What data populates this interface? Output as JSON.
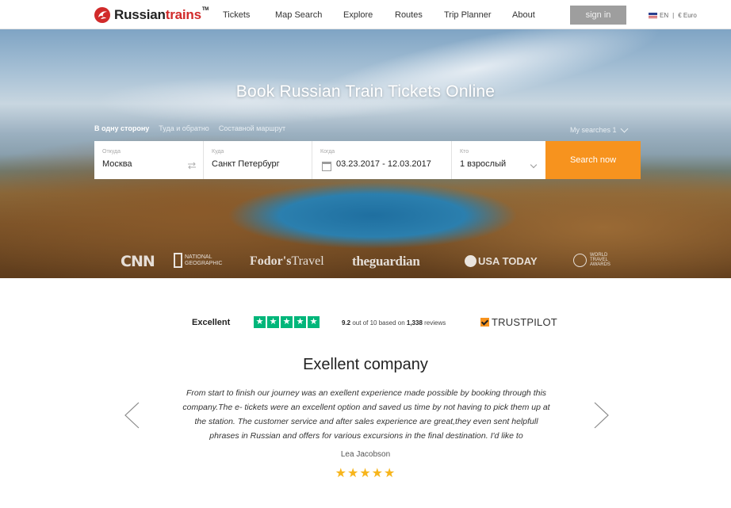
{
  "brand": {
    "name_part1": "Russian",
    "name_part2": "trains",
    "tm": "TM",
    "accent_color": "#d12a2a"
  },
  "nav": {
    "items": [
      "Tickets",
      "Map Search",
      "Explore",
      "Routes",
      "Trip Planner",
      "About"
    ],
    "signin_label": "sign in",
    "lang": "EN",
    "separator": "|",
    "currency": "€ Euro"
  },
  "hero": {
    "title": "Book Russian Train Tickets Online",
    "tabs": [
      "В одну сторону",
      "Туда и обратно",
      "Составной маршрут"
    ],
    "active_tab": 0,
    "my_searches": "My searches 1"
  },
  "search": {
    "from_label": "Откуда",
    "from_value": "Москва",
    "to_label": "Куда",
    "to_value": "Санкт Петербург",
    "date_label": "Когда",
    "date_value": "03.23.2017 - 12.03.2017",
    "who_label": "Кто",
    "who_value": "1 взрослый",
    "button_label": "Search now",
    "button_color": "#f7931e"
  },
  "press": {
    "cnn": "CNN",
    "natgeo_line1": "NATIONAL",
    "natgeo_line2": "GEOGRAPHIC",
    "fodors_bold": "Fodor's",
    "fodors_thin": "Travel",
    "guardian": "theguardian",
    "usatoday": "USA TODAY",
    "wta_line1": "WORLD",
    "wta_line2": "TRAVEL",
    "wta_line3": "AWARDS"
  },
  "trustpilot": {
    "rating_word": "Excellent",
    "score": "9.2",
    "score_suffix": "out of 10 based on",
    "review_count": "1,338",
    "reviews_word": "reviews",
    "brand": "TRUSTPILOT",
    "star_color": "#00b67a",
    "stars": 5
  },
  "review": {
    "title": "Exellent company",
    "text": "From start to finish our journey was an exellent experience made possible by booking through this company.The e- tickets were an excellent option and saved us time by not having to pick them up at the station. The customer service and after sales experience are great,they even sent helpfull phrases in Russian and offers for various excursions in the final destination. I'd like to",
    "author": "Lea Jacobson",
    "rating": 5,
    "stars_text": "★★★★★",
    "star_color": "#f7b51c"
  }
}
